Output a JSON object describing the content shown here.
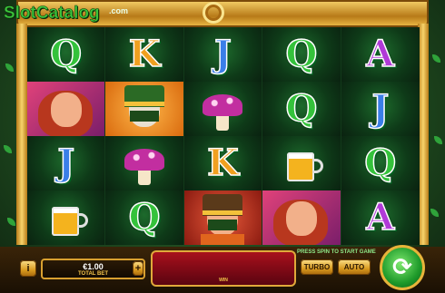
{
  "logo": {
    "text": "SlotCatalog",
    "suffix": ".com"
  },
  "reels": [
    [
      "Q",
      "K",
      "J",
      "Q",
      "A"
    ],
    [
      "redhead-lady",
      "rabbit-leprechaun",
      "mushrooms",
      "Q",
      "J"
    ],
    [
      "J",
      "mushrooms",
      "K",
      "beer-mug",
      "Q"
    ],
    [
      "beer-mug",
      "Q",
      "leprechaun",
      "redhead-lady",
      "A"
    ]
  ],
  "controls": {
    "info_label": "i",
    "minus_label": "−",
    "plus_label": "+",
    "bet_value": "€1.00",
    "bet_label": "TOTAL BET",
    "win_label": "WIN",
    "hint": "PRESS SPIN TO START GAME",
    "turbo_label": "TURBO",
    "auto_label": "AUTO",
    "spin_glyph": "⟳"
  },
  "colors": {
    "accent_gold": "#e8b43a",
    "win_red": "#a8101c",
    "spin_green": "#1e9a2a"
  }
}
